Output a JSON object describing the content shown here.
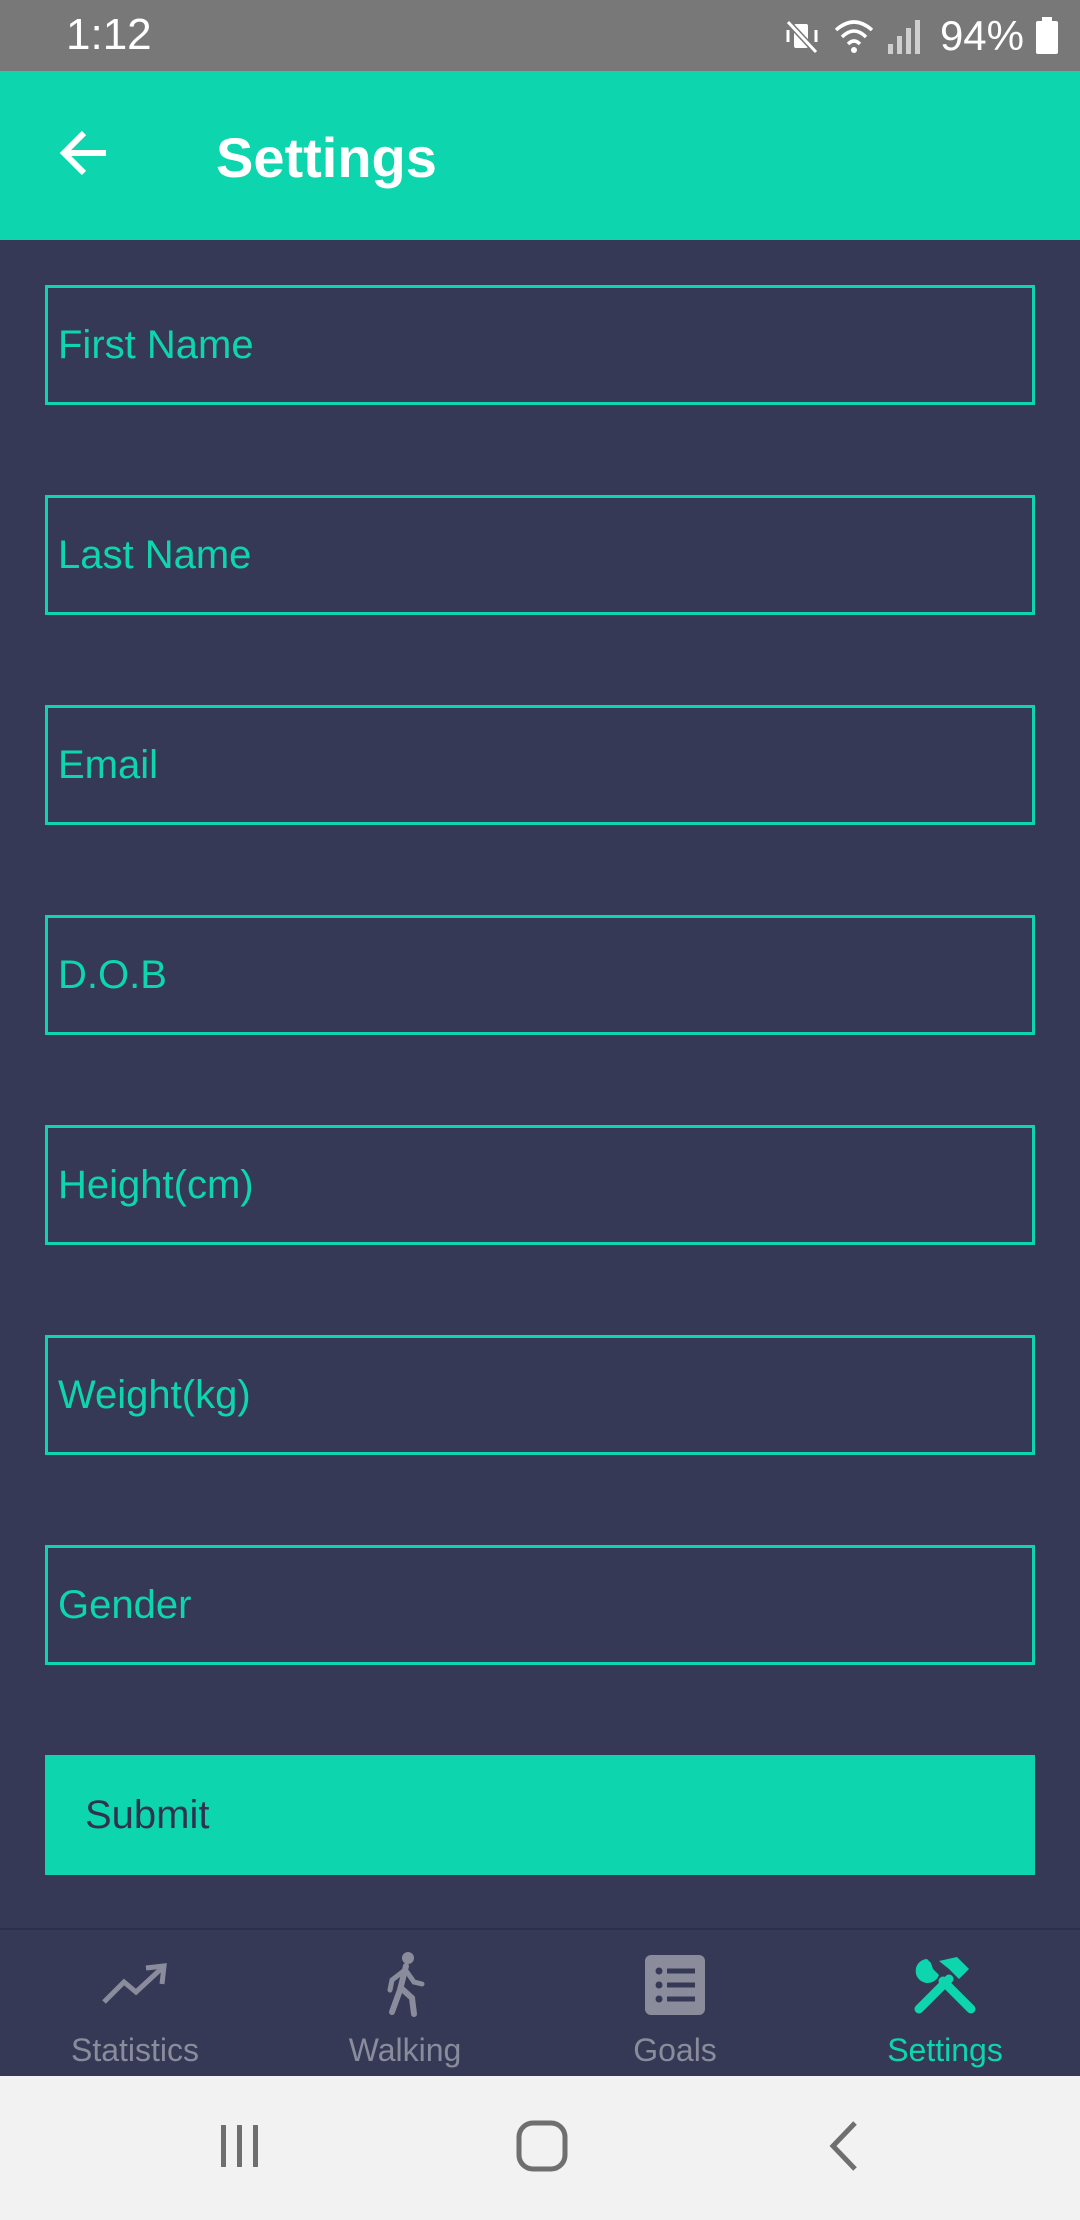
{
  "status_bar": {
    "time": "1:12",
    "battery_percent": "94%",
    "icons": [
      "mute-vibrate-icon",
      "wifi-icon",
      "signal-icon",
      "battery-icon"
    ]
  },
  "app_bar": {
    "title": "Settings",
    "back_icon": "arrow-left-icon",
    "background": "#0dd6ae"
  },
  "form": {
    "fields": [
      {
        "placeholder": "First Name",
        "value": ""
      },
      {
        "placeholder": "Last Name",
        "value": ""
      },
      {
        "placeholder": "Email",
        "value": ""
      },
      {
        "placeholder": "D.O.B",
        "value": ""
      },
      {
        "placeholder": "Height(cm)",
        "value": ""
      },
      {
        "placeholder": "Weight(kg)",
        "value": ""
      },
      {
        "placeholder": "Gender",
        "value": ""
      }
    ],
    "submit_label": "Submit"
  },
  "bottom_nav": {
    "items": [
      {
        "label": "Statistics",
        "icon": "trending-up-icon",
        "active": false
      },
      {
        "label": "Walking",
        "icon": "walking-person-icon",
        "active": false
      },
      {
        "label": "Goals",
        "icon": "list-icon",
        "active": false
      },
      {
        "label": "Settings",
        "icon": "tools-icon",
        "active": true
      }
    ]
  },
  "system_nav": {
    "icons": [
      "recents-icon",
      "home-icon",
      "back-icon"
    ]
  },
  "colors": {
    "accent": "#0dd6ae",
    "background": "#353955",
    "inactive": "#8a8c9c",
    "status_bar": "#787878"
  }
}
